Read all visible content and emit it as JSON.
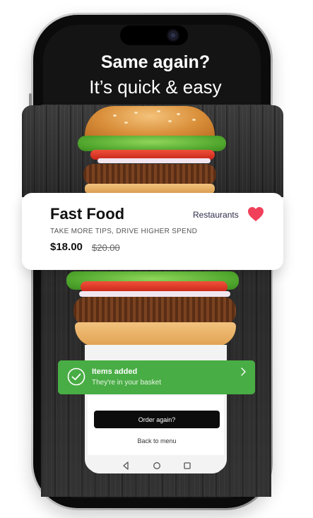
{
  "headline": {
    "line1": "Same again?",
    "line2": "It’s quick & easy"
  },
  "product_card": {
    "title": "Fast Food",
    "category": "Restaurants",
    "subtitle": "TAKE MORE TIPS, DRIVE HIGHER SPEND",
    "price": "$18.00",
    "old_price": "$20.00",
    "favorite_icon": "heart-icon",
    "favorite_color": "#f0405a"
  },
  "toast": {
    "title": "Items added",
    "subtitle": "They're in your basket",
    "icon": "check-circle-icon",
    "color": "#49ad45"
  },
  "actions": {
    "order_again_label": "Order again?",
    "back_to_menu_label": "Back to menu"
  },
  "nav": {
    "icons": [
      "back-triangle-icon",
      "home-circle-icon",
      "recents-square-icon"
    ]
  }
}
